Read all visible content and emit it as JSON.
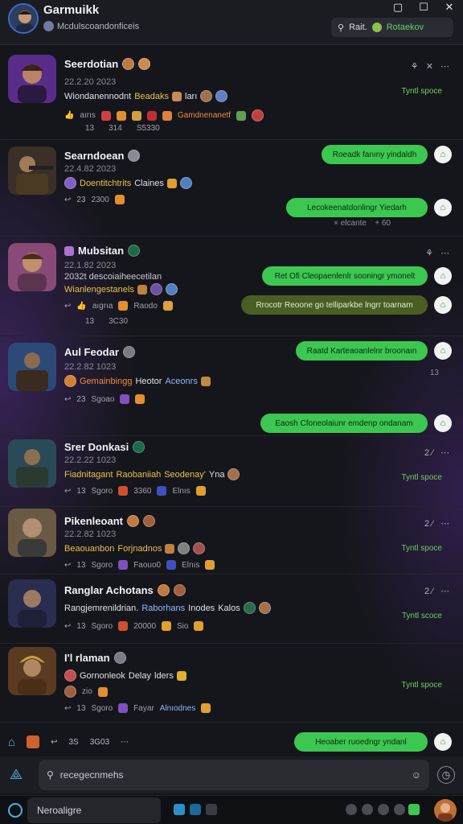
{
  "header": {
    "title": "Garmuikk",
    "subtitle": "Mcdulscoandonficeis",
    "search_label": "Rait.",
    "search_tag": "Rotaekov"
  },
  "posts": [
    {
      "name": "Seerdotian",
      "date": "22.2.20 2023",
      "text_a": "Wiondanennodnt",
      "text_b": "Beadaks",
      "text_c": "ları",
      "stats_a": "aırıs",
      "stats_b": "Gamdnenanetf",
      "sub_a": "13",
      "sub_b": "314",
      "sub_c": "S5330",
      "side": "Tyntl spoce"
    },
    {
      "name": "Searndoean",
      "date": "22.4.82 2023",
      "text_a": "Doentitchtrits",
      "text_b": "Claines",
      "stats_a": "23",
      "stats_b": "2300"
    },
    {
      "name": "Mubsitan",
      "date": "22.1.82 2023",
      "text_pre": "2032t descoiaiheecetilan",
      "text_a": "Wianlengestanels",
      "stats_a": "aıgrıa",
      "stats_b": "Raodo",
      "sub_a": "13",
      "sub_b": "3C30"
    },
    {
      "name": "Aul Feodar",
      "date": "22.2.82 1023",
      "text_a": "Gemainbingg",
      "text_b": "Heotor",
      "text_c": "Aceonrs",
      "stats_a": "23",
      "stats_b": "Sgoao"
    },
    {
      "name": "Srer Donkasi",
      "date": "22.2.22 1023",
      "text_a": "Fiadnitagant",
      "text_b": "Raobaniiah",
      "text_c": "Seodenay'",
      "text_d": "Yna",
      "stats_a": "13",
      "stats_b": "Sgoro",
      "stats_c": "3360",
      "stats_d": "Elnıs",
      "side": "Tyntl spoce"
    },
    {
      "name": "Pikenleoant",
      "date": "22.2.82 1023",
      "text_a": "Beaouanbon",
      "text_b": "Forjnadnos",
      "stats_a": "13",
      "stats_b": "Sgoro",
      "stats_c": "Faouo0",
      "stats_d": "Elnıs",
      "side": "Tyntl spoce"
    },
    {
      "name": "Ranglar Achotans",
      "date": "",
      "text_a": "Rangjemrenildrian.",
      "text_b": "Raborhans",
      "text_c": "Inodes",
      "text_d": "Kalos",
      "stats_a": "13",
      "stats_b": "Sgoro",
      "stats_c": "20000",
      "stats_d": "Sio",
      "side": "Tyntl scoce"
    },
    {
      "name": "I'l rlaman",
      "date": "",
      "text_a": "Gornonleok",
      "text_b": "Delay",
      "text_c": "lders",
      "stats_pre": "zio",
      "stats_a": "13",
      "stats_b": "Sgoro",
      "stats_c": "Fayar",
      "stats_d": "Alnıodnes",
      "side": "Tyntl spoce"
    }
  ],
  "post_side_extras": {
    "p1_icons": "⋯",
    "p2_small": "⋯",
    "p3_sub": "× elcante",
    "p3_sub2": "+ 60",
    "p4_right": "13"
  },
  "bubbles": [
    "Roeadk fanıny yindaldh",
    "Lecokeenatdonlingr Yiedarh",
    "Ret Ofi Cleopaenlenlr sooningr ymonelt",
    "Rrocotr Reoone go telliparkbe lngrr toarnam",
    "Raatd Karteaoanlelnr broonaın",
    "Eaosh Cfoneolaiunr emdenp ondanam",
    "Heoaber ruoedngr yndanl"
  ],
  "bottom": {
    "stat_a": "3S",
    "stat_b": "3G03",
    "message_placeholder": "recegecnmehs",
    "taskbar_input": "Neroaligre"
  },
  "colors": {
    "accent_green": "#3cc751",
    "bubble_olive": "#4a5e22",
    "background": "#15161b"
  }
}
